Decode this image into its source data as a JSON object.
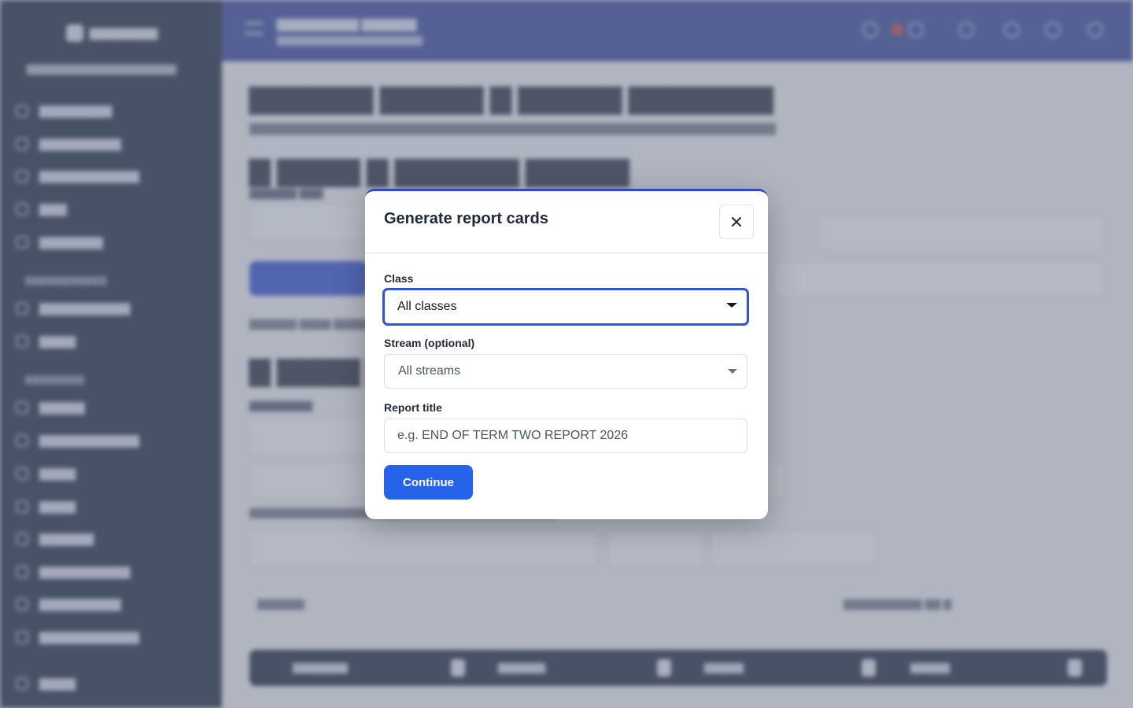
{
  "modal": {
    "title": "Generate report cards",
    "class_label": "Class",
    "class_value": "All classes",
    "stream_label": "Stream (optional)",
    "stream_value": "All streams",
    "report_title_label": "Report title",
    "report_title_placeholder": "e.g. END OF TERM TWO REPORT 2026",
    "report_title_value": "",
    "continue_label": "Continue"
  },
  "colors": {
    "accent": "#2563eb",
    "modal_top_border": "#2b44d6",
    "focus_ring": "#2d55d8",
    "sidebar_bg": "#0f1b33",
    "topbar_bg": "#2b3c98"
  },
  "icons": {
    "close": "close-icon",
    "dropdown": "chevron-down-icon"
  }
}
